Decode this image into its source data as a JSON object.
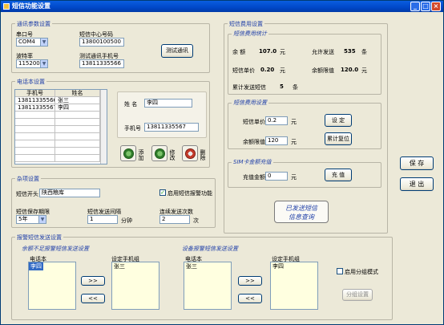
{
  "window": {
    "title": "短信功能设置"
  },
  "comm": {
    "legend": "通讯参数设置",
    "port_label": "串口号",
    "port_value": "COM4",
    "center_label": "短信中心号码",
    "center_value": "13800100500",
    "baud_label": "波特率",
    "baud_value": "115200",
    "test_phone_label": "测试通讯手机号",
    "test_phone_value": "13811335566",
    "test_button": "测试通讯"
  },
  "phonebook": {
    "legend": "电话本设置",
    "columns": [
      "手机号",
      "姓名"
    ],
    "rows": [
      [
        "13811335566",
        "张三"
      ],
      [
        "13811335567",
        "李四"
      ]
    ],
    "name_label": "姓  名",
    "name_value": "李四",
    "phone_label": "手机号",
    "phone_value": "13811335567",
    "add_label": "添加",
    "edit_label": "修改",
    "delete_label": "删除"
  },
  "misc": {
    "legend": "杂项设置",
    "prefix_label": "短信开头",
    "prefix_value": "陕西粮库",
    "enable_alarm_label": "启用短信报警功能",
    "enable_alarm_checked": true,
    "retention_label": "短信保存期限",
    "retention_value": "5年",
    "interval_label": "短信发送间隔",
    "interval_value": "1",
    "interval_unit": "分钟",
    "repeat_label": "连续发送次数",
    "repeat_value": "2",
    "repeat_unit": "次"
  },
  "fees": {
    "legend": "短信费用设置",
    "stats_title": "短信费用统计",
    "balance_label": "余   额",
    "balance_value": "107.0",
    "balance_unit": "元",
    "allowed_label": "允许发送",
    "allowed_value": "535",
    "allowed_unit": "条",
    "price_label": "短信单价",
    "price_value": "0.20",
    "price_unit": "元",
    "limit_label": "余额限值",
    "limit_value": "120.0",
    "limit_unit": "元",
    "sent_label": "累计发送短信",
    "sent_value": "5",
    "sent_unit": "条",
    "settings_title": "短信费用设置",
    "price_input_label": "短信单价",
    "price_input_value": "0.2",
    "price_input_unit": "元",
    "limit_input_label": "余额限值",
    "limit_input_value": "120",
    "limit_input_unit": "元",
    "set_button": "设 定",
    "reset_button": "累计复位",
    "recharge_title": "SIM卡金额充值",
    "recharge_label": "充值金额",
    "recharge_value": "0",
    "recharge_unit": "元",
    "recharge_button": "充 值",
    "query_button_line1": "已发送短信",
    "query_button_line2": "信息查询"
  },
  "alarm": {
    "legend": "报警短信发送设置",
    "noalarm_title": "余额不足报警短信发送设置",
    "noalarm_left_label": "电话本",
    "noalarm_left_items": [
      "李四"
    ],
    "noalarm_right_label": "设定手机组",
    "noalarm_right_items": [
      "张三"
    ],
    "alarm_title": "设备报警短信发送设置",
    "alarm_left_label": "电话本",
    "alarm_left_items": [
      "张三"
    ],
    "alarm_right_label": "设定手机组",
    "alarm_right_items": [
      "李四"
    ],
    "move_right": ">>",
    "move_left": "<<",
    "group_mode_label": "启用分组模式",
    "group_mode_checked": false,
    "group_settings_button": "分组设置"
  },
  "actions": {
    "save": "保 存",
    "exit": "退 出"
  }
}
